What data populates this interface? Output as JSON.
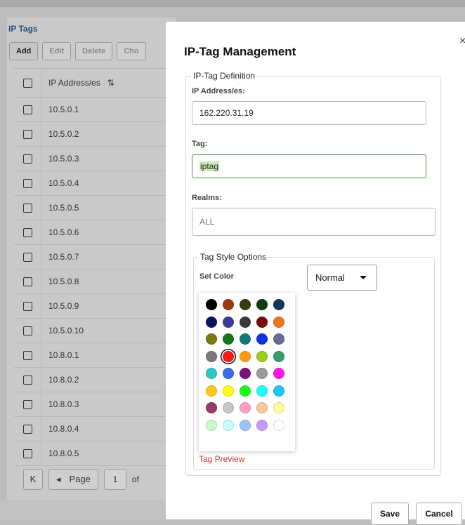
{
  "panel": {
    "title": "IP Tags",
    "toolbar": [
      "Add",
      "Edit",
      "Delete",
      "Cho"
    ],
    "column_header": "IP Address/es",
    "sort_icon": "⇅",
    "rows": [
      "10.5.0.1",
      "10.5.0.2",
      "10.5.0.3",
      "10.5.0.4",
      "10.5.0.5",
      "10.5.0.6",
      "10.5.0.7",
      "10.5.0.8",
      "10.5.0.9",
      "10.5.0.10",
      "10.8.0.1",
      "10.8.0.2",
      "10.8.0.3",
      "10.8.0.4",
      "10.8.0.5"
    ],
    "pager": {
      "first_icon": "K",
      "prev_icon": "◂",
      "page_label": "Page",
      "page_value": "1",
      "of_label": "of"
    }
  },
  "modal": {
    "title": "IP-Tag Management",
    "close_icon": "×",
    "definition_legend": "IP-Tag Definition",
    "ip_label": "IP Address/es:",
    "ip_value": "162.220.31.19",
    "tag_label": "Tag:",
    "tag_value": "iptag",
    "realms_label": "Realms:",
    "realms_value": "ALL",
    "style_legend": "Tag Style Options",
    "set_color_label": "Set Color",
    "font_style_value": "Normal",
    "preview_label": "Tag Preview",
    "save_label": "Save",
    "cancel_label": "Cancel",
    "preview_color": "#c0392b"
  },
  "palette": {
    "colors": [
      "#000000",
      "#9a3b0d",
      "#3b3a0f",
      "#0e3b13",
      "#12375c",
      "#0a1560",
      "#3b3b9a",
      "#3a3a3a",
      "#7a0d0d",
      "#f0761a",
      "#7a7a10",
      "#12781a",
      "#12787a",
      "#1230e6",
      "#6a6a9a",
      "#7a7a7a",
      "#ff1a1a",
      "#ff9a10",
      "#9acc1a",
      "#3a9a6a",
      "#30c6c6",
      "#3a6ae6",
      "#7a127a",
      "#9a9a9a",
      "#ff1ae6",
      "#ffc81a",
      "#ffff10",
      "#1aff1a",
      "#1affff",
      "#1ac6ff",
      "#9a3a6a",
      "#c6c6c6",
      "#ffa0c6",
      "#ffc69a",
      "#ffff9a",
      "#c6ffc6",
      "#c6ffff",
      "#9ac6ff",
      "#c69aff",
      "#ffffff"
    ],
    "selected_index": 16
  }
}
